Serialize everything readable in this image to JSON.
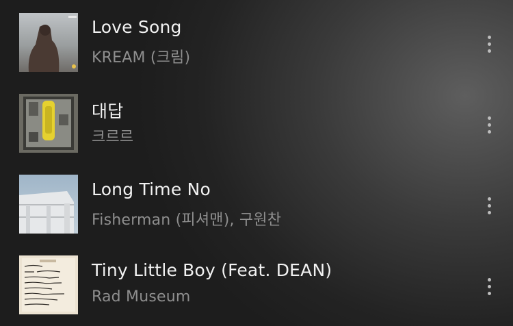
{
  "tracks": [
    {
      "title": "Love Song",
      "artist": "KREAM (크림)",
      "art_icon": "album-art-photo-person"
    },
    {
      "title": "대답",
      "artist": "크르르",
      "art_icon": "album-art-yellow-payphone"
    },
    {
      "title": "Long Time No",
      "artist": "Fisherman (피셔맨), 구원찬",
      "art_icon": "album-art-building-sky"
    },
    {
      "title": "Tiny Little Boy (Feat. DEAN)",
      "artist": "Rad Museum",
      "art_icon": "album-art-handwritten-note"
    }
  ],
  "colors": {
    "title": "#f2f2f2",
    "artist": "#8e8e8e",
    "more_dots": "#bdbdbd"
  }
}
